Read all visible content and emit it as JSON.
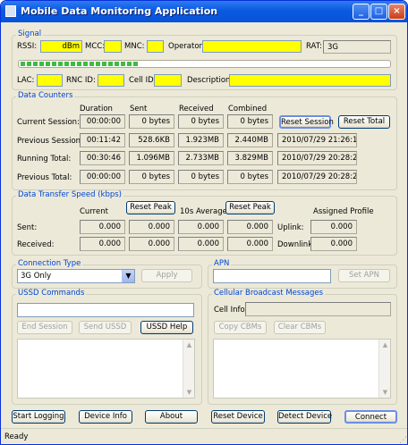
{
  "window": {
    "title": "Mobile Data Monitoring Application"
  },
  "signal": {
    "title": "Signal",
    "rssi_label": "RSSI:",
    "rssi_unit": "dBm",
    "mcc_label": "MCC:",
    "mnc_label": "MNC:",
    "operator_label": "Operator:",
    "rat_label": "RAT:",
    "rat_value": "3G",
    "lac_label": "LAC:",
    "rnc_label": "RNC ID:",
    "cell_label": "Cell ID:",
    "desc_label": "Description:",
    "signal_level": 0.32
  },
  "counters": {
    "title": "Data Counters",
    "headers": [
      "Duration",
      "Sent",
      "Received",
      "Combined"
    ],
    "rows": [
      {
        "label": "Current Session:",
        "values": [
          "00:00:00",
          "0 bytes",
          "0 bytes",
          "0 bytes"
        ]
      },
      {
        "label": "Previous Session:",
        "values": [
          "00:11:42",
          "528.6KB",
          "1.923MB",
          "2.440MB"
        ],
        "extra": "2010/07/29 21:26:12"
      },
      {
        "label": "Running Total:",
        "values": [
          "00:30:46",
          "1.096MB",
          "2.733MB",
          "3.829MB"
        ],
        "extra": "2010/07/29 20:28:22"
      },
      {
        "label": "Previous Total:",
        "values": [
          "00:00:00",
          "0 bytes",
          "0 bytes",
          "0 bytes"
        ],
        "extra": "2010/07/29 20:28:22"
      }
    ],
    "reset_session": "Reset Session",
    "reset_total": "Reset Total"
  },
  "speed": {
    "title": "Data Transfer Speed (kbps)",
    "current_label": "Current",
    "avg_label": "10s Average",
    "reset_peak": "Reset Peak",
    "assigned_label": "Assigned Profile",
    "sent_label": "Sent:",
    "received_label": "Received:",
    "uplink_label": "Uplink:",
    "downlink_label": "Downlink:",
    "sent": [
      "0.000",
      "0.000",
      "0.000",
      "0.000"
    ],
    "received": [
      "0.000",
      "0.000",
      "0.000",
      "0.000"
    ],
    "uplink": "0.000",
    "downlink": "0.000"
  },
  "connection": {
    "title": "Connection Type",
    "selected": "3G Only",
    "apply": "Apply"
  },
  "apn": {
    "title": "APN",
    "set": "Set APN"
  },
  "ussd": {
    "title": "USSD Commands",
    "end": "End Session",
    "send": "Send USSD",
    "help": "USSD Help"
  },
  "cbm": {
    "title": "Cellular Broadcast Messages",
    "cell_info": "Cell Info:",
    "copy": "Copy CBMs",
    "clear": "Clear CBMs"
  },
  "buttons": {
    "start": "Start Logging",
    "device": "Device Info",
    "about": "About",
    "reset": "Reset Device",
    "detect": "Detect Device",
    "connect": "Connect"
  },
  "status": "Ready"
}
